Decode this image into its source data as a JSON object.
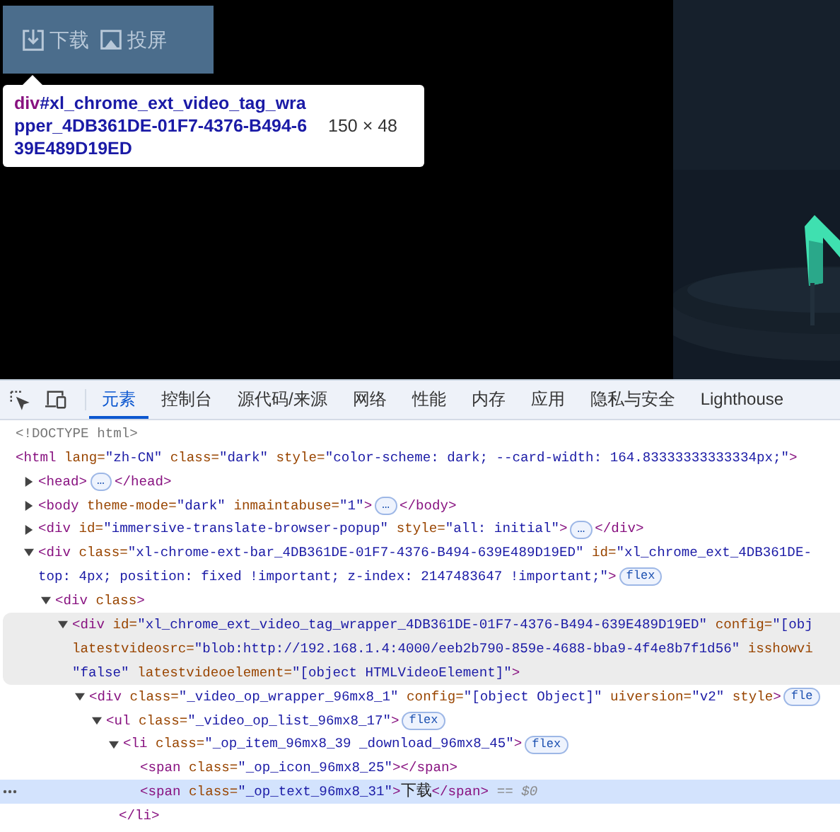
{
  "video_overlay": {
    "buttons": [
      {
        "kind": "download",
        "label": "下载"
      },
      {
        "kind": "cast",
        "label": "投屏"
      }
    ]
  },
  "inspect_tooltip": {
    "tag": "div",
    "id": "#xl_chrome_ext_video_tag_wrapper_4DB361DE-01F7-4376-B494-639E489D19ED",
    "size": "150 × 48"
  },
  "devtools": {
    "tools": [
      {
        "kind": "inspect"
      },
      {
        "kind": "device"
      }
    ],
    "tabs": [
      {
        "label": "元素",
        "selected": true
      },
      {
        "label": "控制台",
        "selected": false
      },
      {
        "label": "源代码/来源",
        "selected": false
      },
      {
        "label": "网络",
        "selected": false
      },
      {
        "label": "性能",
        "selected": false
      },
      {
        "label": "内存",
        "selected": false
      },
      {
        "label": "应用",
        "selected": false
      },
      {
        "label": "隐私与安全",
        "selected": false
      },
      {
        "label": "Lighthouse",
        "selected": false
      }
    ],
    "tree": [
      {
        "selected": false,
        "hovered": false,
        "lines": [
          [
            {
              "kind": "doctype",
              "text": "<!DOCTYPE html>"
            }
          ]
        ]
      },
      {
        "selected": false,
        "hovered": false,
        "lines": [
          [
            {
              "kind": "tag",
              "text": "<html"
            },
            {
              "kind": "attr",
              "text": " lang="
            },
            {
              "kind": "value",
              "text": "\"zh-CN\""
            },
            {
              "kind": "attr",
              "text": " class="
            },
            {
              "kind": "value",
              "text": "\"dark\""
            },
            {
              "kind": "attr",
              "text": " style="
            },
            {
              "kind": "value",
              "text": "\"color-scheme: dark; --card-width: 164.83333333333334px;\""
            },
            {
              "kind": "tag",
              "text": ">"
            }
          ]
        ],
        "children": [
          {
            "expanded": false,
            "selected": false,
            "hovered": false,
            "lines": [
              [
                {
                  "kind": "tag",
                  "text": "<head>"
                },
                {
                  "kind": "more",
                  "text": "…"
                },
                {
                  "kind": "tag",
                  "text": "</head>"
                }
              ]
            ]
          },
          {
            "expanded": false,
            "selected": false,
            "hovered": false,
            "lines": [
              [
                {
                  "kind": "tag",
                  "text": "<body"
                },
                {
                  "kind": "attr",
                  "text": " theme-mode="
                },
                {
                  "kind": "value",
                  "text": "\"dark\""
                },
                {
                  "kind": "attr",
                  "text": " inmaintabuse="
                },
                {
                  "kind": "value",
                  "text": "\"1\""
                },
                {
                  "kind": "tag",
                  "text": ">"
                },
                {
                  "kind": "more",
                  "text": "…"
                },
                {
                  "kind": "tag",
                  "text": "</body>"
                }
              ]
            ]
          },
          {
            "expanded": false,
            "selected": false,
            "hovered": false,
            "lines": [
              [
                {
                  "kind": "tag",
                  "text": "<div"
                },
                {
                  "kind": "attr",
                  "text": " id="
                },
                {
                  "kind": "value",
                  "text": "\"immersive-translate-browser-popup\""
                },
                {
                  "kind": "attr",
                  "text": " style="
                },
                {
                  "kind": "value",
                  "text": "\"all: initial\""
                },
                {
                  "kind": "tag",
                  "text": ">"
                },
                {
                  "kind": "more",
                  "text": "…"
                },
                {
                  "kind": "tag",
                  "text": "</div>"
                }
              ]
            ]
          },
          {
            "expanded": true,
            "selected": false,
            "hovered": false,
            "lines": [
              [
                {
                  "kind": "tag",
                  "text": "<div"
                },
                {
                  "kind": "attr",
                  "text": " class="
                },
                {
                  "kind": "value",
                  "text": "\"xl-chrome-ext-bar_4DB361DE-01F7-4376-B494-639E489D19ED\""
                },
                {
                  "kind": "attr",
                  "text": " id="
                },
                {
                  "kind": "value",
                  "text": "\"xl_chrome_ext_4DB361DE-"
                }
              ],
              [
                {
                  "kind": "value",
                  "text": "top: 4px; position: fixed !important; z-index: 2147483647 !important;\""
                },
                {
                  "kind": "tag",
                  "text": ">"
                },
                {
                  "kind": "badge",
                  "text": "flex"
                }
              ]
            ],
            "children": [
              {
                "expanded": true,
                "selected": false,
                "hovered": false,
                "lines": [
                  [
                    {
                      "kind": "tag",
                      "text": "<div"
                    },
                    {
                      "kind": "attr",
                      "text": " class"
                    },
                    {
                      "kind": "tag",
                      "text": ">"
                    }
                  ]
                ],
                "children": [
                  {
                    "expanded": true,
                    "selected": false,
                    "hovered": true,
                    "lines": [
                      [
                        {
                          "kind": "tag",
                          "text": "<div"
                        },
                        {
                          "kind": "attr",
                          "text": " id="
                        },
                        {
                          "kind": "value",
                          "text": "\"xl_chrome_ext_video_tag_wrapper_4DB361DE-01F7-4376-B494-639E489D19ED\""
                        },
                        {
                          "kind": "attr",
                          "text": " config="
                        },
                        {
                          "kind": "value",
                          "text": "\"[obj"
                        }
                      ],
                      [
                        {
                          "kind": "attr",
                          "text": "latestvideosrc="
                        },
                        {
                          "kind": "value",
                          "text": "\"blob:http://192.168.1.4:4000/eeb2b790-859e-4688-bba9-4f4e8b7f1d56\""
                        },
                        {
                          "kind": "attr",
                          "text": " isshowvi"
                        }
                      ],
                      [
                        {
                          "kind": "value",
                          "text": "\"false\""
                        },
                        {
                          "kind": "attr",
                          "text": " latestvideoelement="
                        },
                        {
                          "kind": "value",
                          "text": "\"[object HTMLVideoElement]\""
                        },
                        {
                          "kind": "tag",
                          "text": ">"
                        }
                      ]
                    ],
                    "children": [
                      {
                        "expanded": true,
                        "selected": false,
                        "hovered": false,
                        "lines": [
                          [
                            {
                              "kind": "tag",
                              "text": "<div"
                            },
                            {
                              "kind": "attr",
                              "text": " class="
                            },
                            {
                              "kind": "value",
                              "text": "\"_video_op_wrapper_96mx8_1\""
                            },
                            {
                              "kind": "attr",
                              "text": " config="
                            },
                            {
                              "kind": "value",
                              "text": "\"[object Object]\""
                            },
                            {
                              "kind": "attr",
                              "text": " uiversion="
                            },
                            {
                              "kind": "value",
                              "text": "\"v2\""
                            },
                            {
                              "kind": "attr",
                              "text": " style"
                            },
                            {
                              "kind": "tag",
                              "text": ">"
                            },
                            {
                              "kind": "badge",
                              "text": "fle"
                            }
                          ]
                        ],
                        "children": [
                          {
                            "expanded": true,
                            "selected": false,
                            "hovered": false,
                            "lines": [
                              [
                                {
                                  "kind": "tag",
                                  "text": "<ul"
                                },
                                {
                                  "kind": "attr",
                                  "text": " class="
                                },
                                {
                                  "kind": "value",
                                  "text": "\"_video_op_list_96mx8_17\""
                                },
                                {
                                  "kind": "tag",
                                  "text": ">"
                                },
                                {
                                  "kind": "badge",
                                  "text": "flex"
                                }
                              ]
                            ],
                            "children": [
                              {
                                "expanded": true,
                                "selected": false,
                                "hovered": false,
                                "lines": [
                                  [
                                    {
                                      "kind": "tag",
                                      "text": "<li"
                                    },
                                    {
                                      "kind": "attr",
                                      "text": " class="
                                    },
                                    {
                                      "kind": "value",
                                      "text": "\"_op_item_96mx8_39 _download_96mx8_45\""
                                    },
                                    {
                                      "kind": "tag",
                                      "text": ">"
                                    },
                                    {
                                      "kind": "badge",
                                      "text": "flex"
                                    }
                                  ]
                                ],
                                "close": [
                                  {
                                    "kind": "tag",
                                    "text": "</li>"
                                  }
                                ],
                                "children": [
                                  {
                                    "selected": false,
                                    "hovered": false,
                                    "lines": [
                                      [
                                        {
                                          "kind": "tag",
                                          "text": "<span"
                                        },
                                        {
                                          "kind": "attr",
                                          "text": " class="
                                        },
                                        {
                                          "kind": "value",
                                          "text": "\"_op_icon_96mx8_25\""
                                        },
                                        {
                                          "kind": "tag",
                                          "text": "></span>"
                                        }
                                      ]
                                    ]
                                  },
                                  {
                                    "selected": true,
                                    "hovered": false,
                                    "lines": [
                                      [
                                        {
                                          "kind": "tag",
                                          "text": "<span"
                                        },
                                        {
                                          "kind": "attr",
                                          "text": " class="
                                        },
                                        {
                                          "kind": "value",
                                          "text": "\"_op_text_96mx8_31\""
                                        },
                                        {
                                          "kind": "tag",
                                          "text": ">"
                                        },
                                        {
                                          "kind": "text",
                                          "text": "下载"
                                        },
                                        {
                                          "kind": "tag",
                                          "text": "</span>"
                                        },
                                        {
                                          "kind": "ref",
                                          "text": " == $0"
                                        }
                                      ]
                                    ]
                                  }
                                ]
                              }
                            ]
                          }
                        ]
                      }
                    ]
                  }
                ]
              }
            ]
          }
        ]
      }
    ]
  }
}
